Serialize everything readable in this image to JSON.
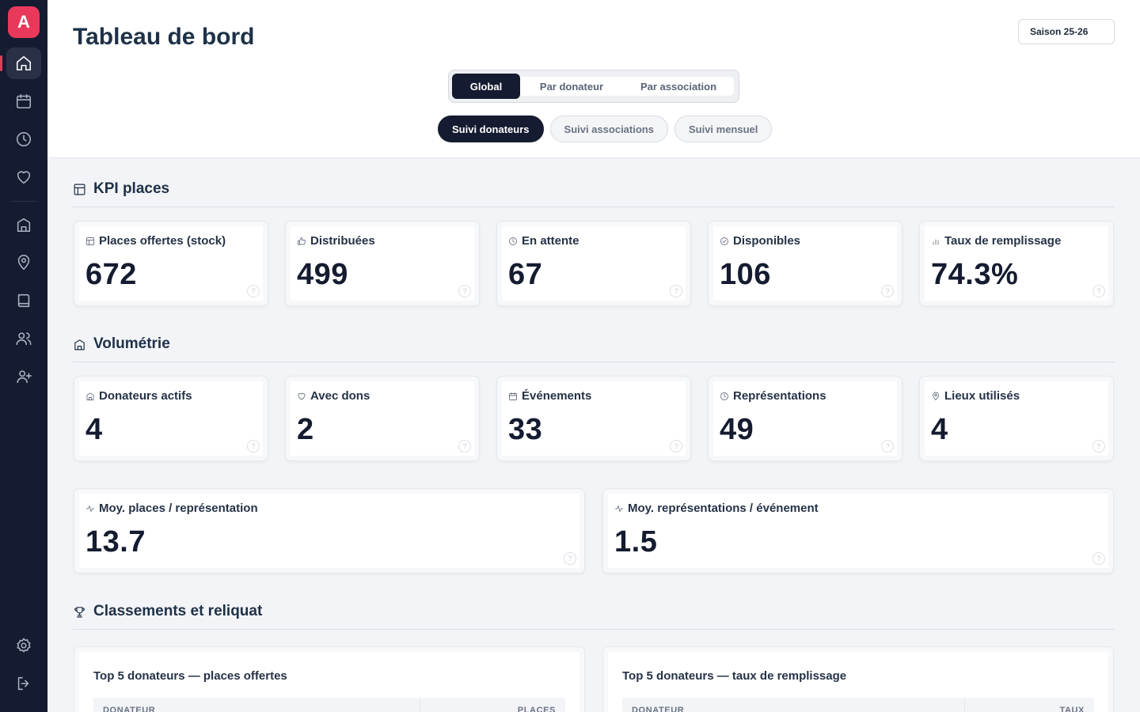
{
  "app": {
    "logo_letter": "A"
  },
  "sidebar": {
    "items": [
      {
        "icon": "home-icon",
        "active": true
      },
      {
        "icon": "calendar-icon"
      },
      {
        "icon": "clock-icon"
      },
      {
        "icon": "heart-icon"
      },
      {
        "icon": "building-icon"
      },
      {
        "icon": "map-pin-icon"
      },
      {
        "icon": "book-icon"
      },
      {
        "icon": "users-icon"
      },
      {
        "icon": "user-plus-icon"
      },
      {
        "icon": "gear-icon"
      },
      {
        "icon": "logout-icon"
      }
    ]
  },
  "header": {
    "title": "Tableau de bord",
    "season": "Saison 25-26",
    "view_tabs": [
      "Global",
      "Par donateur",
      "Par association"
    ],
    "pills": [
      "Suivi donateurs",
      "Suivi associations",
      "Suivi mensuel"
    ]
  },
  "kpi": {
    "title": "KPI places",
    "cards": [
      {
        "label": "Places offertes (stock)",
        "value": "672",
        "icon": "box-icon"
      },
      {
        "label": "Distribuées",
        "value": "499",
        "icon": "thumbs-up-icon"
      },
      {
        "label": "En attente",
        "value": "67",
        "icon": "clock-icon"
      },
      {
        "label": "Disponibles",
        "value": "106",
        "icon": "check-circle-icon"
      },
      {
        "label": "Taux de remplissage",
        "value": "74.3%",
        "icon": "bar-chart-icon"
      }
    ]
  },
  "volume": {
    "title": "Volumétrie",
    "cards": [
      {
        "label": "Donateurs actifs",
        "value": "4",
        "icon": "building-icon"
      },
      {
        "label": "Avec dons",
        "value": "2",
        "icon": "heart-icon"
      },
      {
        "label": "Événements",
        "value": "33",
        "icon": "calendar-icon"
      },
      {
        "label": "Représentations",
        "value": "49",
        "icon": "clock-icon"
      },
      {
        "label": "Lieux utilisés",
        "value": "4",
        "icon": "map-pin-icon"
      }
    ],
    "wide_cards": [
      {
        "label": "Moy. places / représentation",
        "value": "13.7",
        "icon": "activity-icon"
      },
      {
        "label": "Moy. représentations / événement",
        "value": "1.5",
        "icon": "activity-icon"
      }
    ]
  },
  "ranking": {
    "title": "Classements et reliquat",
    "tables": [
      {
        "title": "Top 5 donateurs — places offertes",
        "col1": "DONATEUR",
        "col2": "PLACES"
      },
      {
        "title": "Top 5 donateurs — taux de remplissage",
        "col1": "DONATEUR",
        "col2": "TAUX"
      }
    ]
  },
  "help_glyph": "?"
}
